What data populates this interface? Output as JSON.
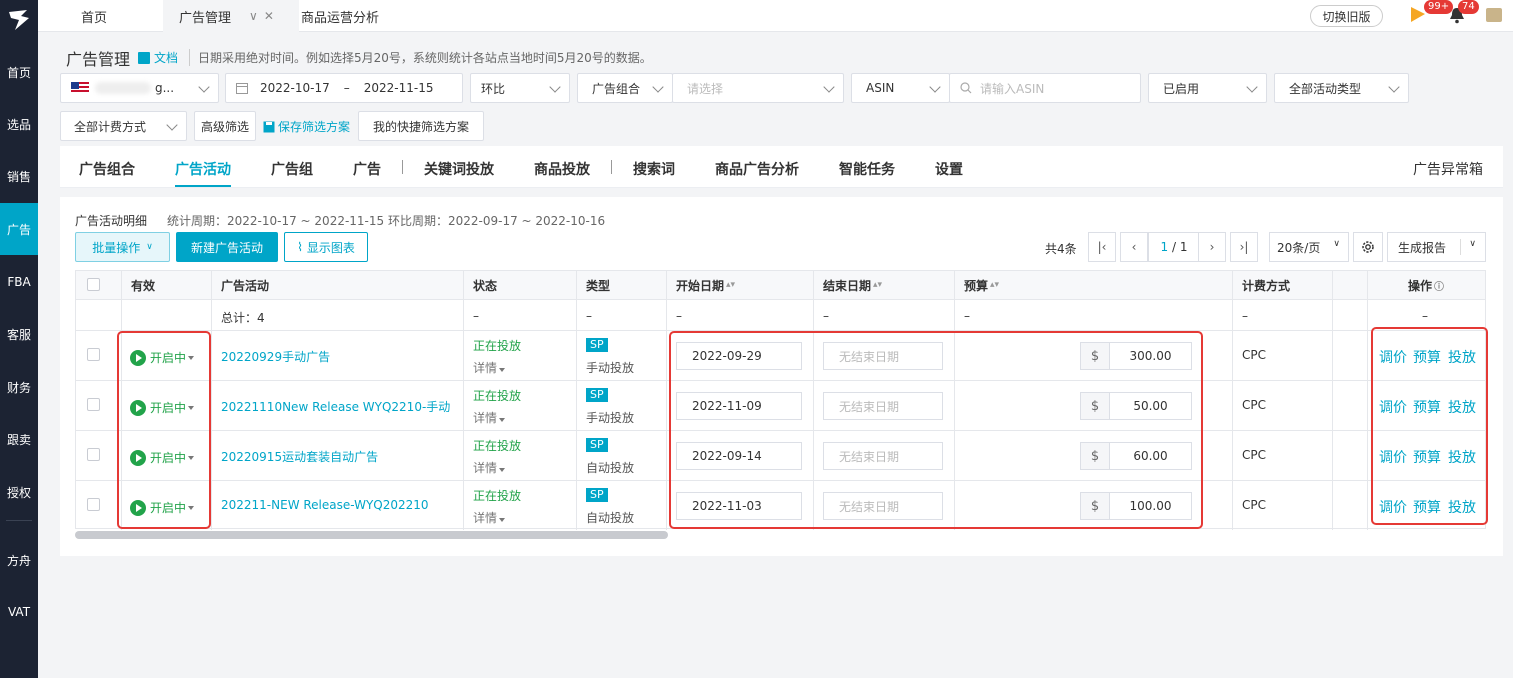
{
  "nav": {
    "items": [
      {
        "label": "首页"
      },
      {
        "label": "选品"
      },
      {
        "label": "销售"
      },
      {
        "label": "广告"
      },
      {
        "label": "FBA"
      },
      {
        "label": "客服"
      },
      {
        "label": "财务"
      },
      {
        "label": "跟卖"
      },
      {
        "label": "授权"
      },
      {
        "label": "方舟"
      },
      {
        "label": "VAT"
      }
    ],
    "active": "广告"
  },
  "top_tabs": [
    {
      "label": "首页"
    },
    {
      "label": "广告管理"
    },
    {
      "label": "商品运营分析"
    }
  ],
  "top_right": {
    "switch_old_label": "切换旧版",
    "flag_badge": "99+",
    "bell_badge": "74"
  },
  "page": {
    "title": "广告管理",
    "doc_label": "文档",
    "hint": "日期采用绝对时间。例如选择5月20号，系统则统计各站点当地时间5月20号的数据。"
  },
  "filters": {
    "store_suffix": "g...",
    "date_start": "2022-10-17",
    "date_sep": "–",
    "date_end": "2022-11-15",
    "compare": "环比",
    "group_type": "广告组合",
    "group_placeholder": "请选择",
    "id_type": "ASIN",
    "asin_placeholder": "请输入ASIN",
    "status": "已启用",
    "campaign_type": "全部活动类型",
    "billing": "全部计费方式",
    "advanced": "高级筛选",
    "save_scheme": "保存筛选方案",
    "my_schemes": "我的快捷筛选方案"
  },
  "sub_tabs": [
    "广告组合",
    "广告活动",
    "广告组",
    "广告",
    "关键词投放",
    "商品投放",
    "搜索词",
    "商品广告分析",
    "智能任务",
    "设置"
  ],
  "sub_tabs_active": "广告活动",
  "sub_tabs_right": "广告异常箱",
  "panel": {
    "title": "广告活动明细",
    "stats": "统计周期：2022-10-17 ~ 2022-11-15 环比周期：2022-09-17 ~ 2022-10-16",
    "batch_label": "批量操作",
    "new_label": "新建广告活动",
    "chart_label": "显示图表",
    "total": "共4条",
    "page_current": "1",
    "page_total": "/ 1",
    "per_page": "20条/页",
    "report_label": "生成报告"
  },
  "table": {
    "headers": {
      "enabled": "有效",
      "campaign": "广告活动",
      "status": "状态",
      "type": "类型",
      "start": "开始日期",
      "end": "结束日期",
      "budget": "预算",
      "billing": "计费方式",
      "ops": "操作"
    },
    "summary": {
      "total": "总计：4",
      "dash": "–"
    },
    "rows": [
      {
        "enabled": "开启中",
        "campaign": "20220929手动广告",
        "status": "正在投放",
        "detail": "详情",
        "type_badge": "SP",
        "type": "手动投放",
        "start": "2022-09-29",
        "end_placeholder": "无结束日期",
        "currency": "$",
        "budget": "300.00",
        "billing": "CPC"
      },
      {
        "enabled": "开启中",
        "campaign": "20221110New Release WYQ2210-手动",
        "status": "正在投放",
        "detail": "详情",
        "type_badge": "SP",
        "type": "手动投放",
        "start": "2022-11-09",
        "end_placeholder": "无结束日期",
        "currency": "$",
        "budget": "50.00",
        "billing": "CPC"
      },
      {
        "enabled": "开启中",
        "campaign": "20220915运动套装自动广告",
        "status": "正在投放",
        "detail": "详情",
        "type_badge": "SP",
        "type": "自动投放",
        "start": "2022-09-14",
        "end_placeholder": "无结束日期",
        "currency": "$",
        "budget": "60.00",
        "billing": "CPC"
      },
      {
        "enabled": "开启中",
        "campaign": "202211-NEW Release-WYQ202210",
        "status": "正在投放",
        "detail": "详情",
        "type_badge": "SP",
        "type": "自动投放",
        "start": "2022-11-03",
        "end_placeholder": "无结束日期",
        "currency": "$",
        "budget": "100.00",
        "billing": "CPC"
      }
    ],
    "actions": [
      "调价",
      "预算",
      "投放"
    ]
  },
  "colors": {
    "accent": "#00a5c8",
    "enabled_green": "#22a34a",
    "highlight_red": "#e53935",
    "nav_bg": "#1c2333"
  }
}
